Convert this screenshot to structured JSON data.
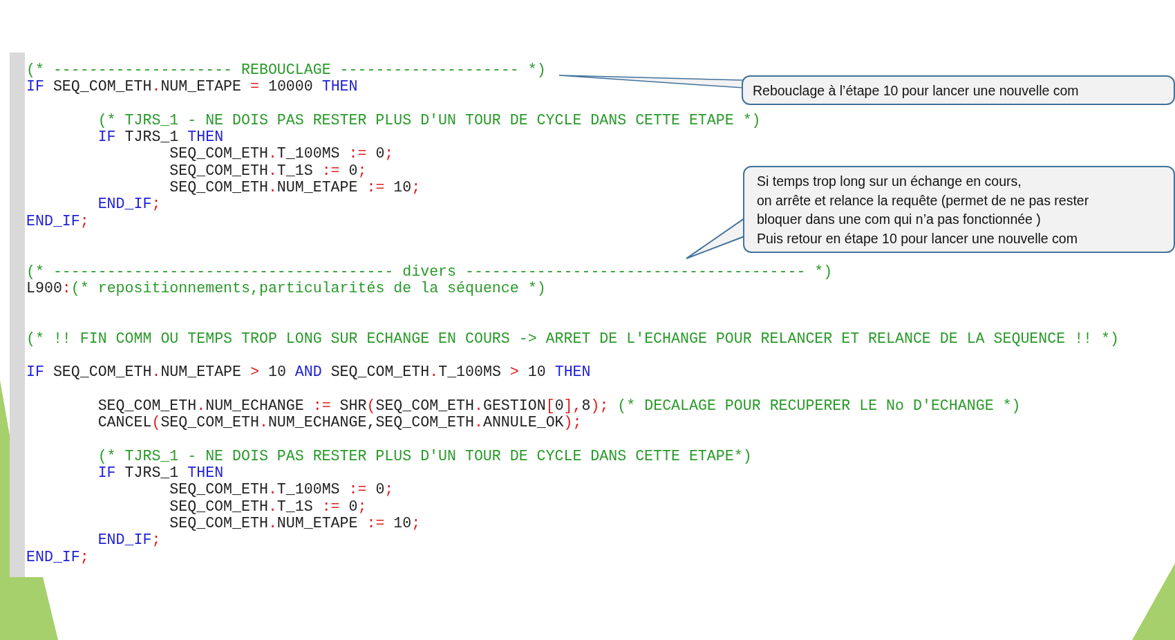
{
  "code_lines": [
    {
      "kind": "code",
      "tokens": [
        {
          "kind": "comment",
          "text": "(* -------------------- REBOUCLAGE -------------------- *)"
        }
      ]
    },
    {
      "kind": "code",
      "tokens": [
        {
          "kind": "keyword",
          "text": "IF"
        },
        {
          "kind": "plain",
          "text": " SEQ_COM_ETH"
        },
        {
          "kind": "operator",
          "text": "."
        },
        {
          "kind": "plain",
          "text": "NUM_ETAPE "
        },
        {
          "kind": "operator",
          "text": "="
        },
        {
          "kind": "plain",
          "text": " 10000 "
        },
        {
          "kind": "keyword",
          "text": "THEN"
        }
      ],
      "children": [
        {
          "kind": "blank"
        },
        {
          "kind": "code",
          "tokens": [
            {
              "kind": "comment",
              "text": "(* TJRS_1 - NE DOIS PAS RESTER PLUS D'UN TOUR DE CYCLE DANS CETTE ETAPE *)"
            }
          ]
        },
        {
          "kind": "code",
          "tokens": [
            {
              "kind": "keyword",
              "text": "IF"
            },
            {
              "kind": "plain",
              "text": " TJRS_1 "
            },
            {
              "kind": "keyword",
              "text": "THEN"
            }
          ],
          "children": [
            {
              "kind": "code",
              "tokens": [
                {
                  "kind": "plain",
                  "text": "SEQ_COM_ETH"
                },
                {
                  "kind": "operator",
                  "text": "."
                },
                {
                  "kind": "plain",
                  "text": "T_100MS "
                },
                {
                  "kind": "operator",
                  "text": ":="
                },
                {
                  "kind": "plain",
                  "text": " 0"
                },
                {
                  "kind": "operator",
                  "text": ";"
                }
              ]
            },
            {
              "kind": "code",
              "tokens": [
                {
                  "kind": "plain",
                  "text": "SEQ_COM_ETH"
                },
                {
                  "kind": "operator",
                  "text": "."
                },
                {
                  "kind": "plain",
                  "text": "T_1S "
                },
                {
                  "kind": "operator",
                  "text": ":="
                },
                {
                  "kind": "plain",
                  "text": " 0"
                },
                {
                  "kind": "operator",
                  "text": ";"
                }
              ]
            },
            {
              "kind": "code",
              "tokens": [
                {
                  "kind": "plain",
                  "text": "SEQ_COM_ETH"
                },
                {
                  "kind": "operator",
                  "text": "."
                },
                {
                  "kind": "plain",
                  "text": "NUM_ETAPE "
                },
                {
                  "kind": "operator",
                  "text": ":="
                },
                {
                  "kind": "plain",
                  "text": " 10"
                },
                {
                  "kind": "operator",
                  "text": ";"
                }
              ]
            }
          ]
        },
        {
          "kind": "code",
          "tokens": [
            {
              "kind": "keyword",
              "text": "END_IF"
            },
            {
              "kind": "operator",
              "text": ";"
            }
          ]
        }
      ]
    },
    {
      "kind": "code",
      "tokens": [
        {
          "kind": "keyword",
          "text": "END_IF"
        },
        {
          "kind": "operator",
          "text": ";"
        }
      ]
    },
    {
      "kind": "blank"
    },
    {
      "kind": "blank"
    },
    {
      "kind": "code",
      "tokens": [
        {
          "kind": "comment",
          "text": "(* -------------------------------------- divers -------------------------------------- *)"
        }
      ]
    },
    {
      "kind": "code",
      "tokens": [
        {
          "kind": "plain",
          "text": "L900"
        },
        {
          "kind": "operator",
          "text": ":"
        },
        {
          "kind": "comment",
          "text": "(* repositionnements,particularités de la séquence *)"
        }
      ]
    },
    {
      "kind": "blank"
    },
    {
      "kind": "blank"
    },
    {
      "kind": "code",
      "tokens": [
        {
          "kind": "comment",
          "text": "(* !! FIN COMM OU TEMPS TROP LONG SUR ECHANGE EN COURS -> ARRET DE L'ECHANGE POUR RELANCER ET RELANCE DE LA SEQUENCE !! *)"
        }
      ]
    },
    {
      "kind": "blank"
    },
    {
      "kind": "code",
      "tokens": [
        {
          "kind": "keyword",
          "text": "IF"
        },
        {
          "kind": "plain",
          "text": " SEQ_COM_ETH"
        },
        {
          "kind": "operator",
          "text": "."
        },
        {
          "kind": "plain",
          "text": "NUM_ETAPE "
        },
        {
          "kind": "operator",
          "text": ">"
        },
        {
          "kind": "plain",
          "text": " 10 "
        },
        {
          "kind": "keyword",
          "text": "AND"
        },
        {
          "kind": "plain",
          "text": " SEQ_COM_ETH"
        },
        {
          "kind": "operator",
          "text": "."
        },
        {
          "kind": "plain",
          "text": "T_100MS "
        },
        {
          "kind": "operator",
          "text": ">"
        },
        {
          "kind": "plain",
          "text": " 10 "
        },
        {
          "kind": "keyword",
          "text": "THEN"
        }
      ],
      "children": [
        {
          "kind": "blank"
        },
        {
          "kind": "code",
          "tokens": [
            {
              "kind": "plain",
              "text": "SEQ_COM_ETH"
            },
            {
              "kind": "operator",
              "text": "."
            },
            {
              "kind": "plain",
              "text": "NUM_ECHANGE "
            },
            {
              "kind": "operator",
              "text": ":="
            },
            {
              "kind": "plain",
              "text": " SHR"
            },
            {
              "kind": "operator",
              "text": "("
            },
            {
              "kind": "plain",
              "text": "SEQ_COM_ETH"
            },
            {
              "kind": "operator",
              "text": "."
            },
            {
              "kind": "plain",
              "text": "GESTION"
            },
            {
              "kind": "operator",
              "text": "["
            },
            {
              "kind": "plain",
              "text": "0"
            },
            {
              "kind": "operator",
              "text": "],"
            },
            {
              "kind": "plain",
              "text": "8"
            },
            {
              "kind": "operator",
              "text": ");"
            },
            {
              "kind": "comment",
              "text": " (* DECALAGE POUR RECUPERER LE No D'ECHANGE *)"
            }
          ]
        },
        {
          "kind": "code",
          "tokens": [
            {
              "kind": "plain",
              "text": "CANCEL"
            },
            {
              "kind": "operator",
              "text": "("
            },
            {
              "kind": "plain",
              "text": "SEQ_COM_ETH"
            },
            {
              "kind": "operator",
              "text": "."
            },
            {
              "kind": "plain",
              "text": "NUM_ECHANGE,SEQ_COM_ETH"
            },
            {
              "kind": "operator",
              "text": "."
            },
            {
              "kind": "plain",
              "text": "ANNULE_OK"
            },
            {
              "kind": "operator",
              "text": ");"
            }
          ]
        },
        {
          "kind": "blank"
        },
        {
          "kind": "code",
          "tokens": [
            {
              "kind": "comment",
              "text": "(* TJRS_1 - NE DOIS PAS RESTER PLUS D'UN TOUR DE CYCLE DANS CETTE ETAPE*)"
            }
          ]
        },
        {
          "kind": "code",
          "tokens": [
            {
              "kind": "keyword",
              "text": "IF"
            },
            {
              "kind": "plain",
              "text": " TJRS_1 "
            },
            {
              "kind": "keyword",
              "text": "THEN"
            }
          ],
          "children": [
            {
              "kind": "code",
              "tokens": [
                {
                  "kind": "plain",
                  "text": "SEQ_COM_ETH"
                },
                {
                  "kind": "operator",
                  "text": "."
                },
                {
                  "kind": "plain",
                  "text": "T_100MS "
                },
                {
                  "kind": "operator",
                  "text": ":="
                },
                {
                  "kind": "plain",
                  "text": " 0"
                },
                {
                  "kind": "operator",
                  "text": ";"
                }
              ]
            },
            {
              "kind": "code",
              "tokens": [
                {
                  "kind": "plain",
                  "text": "SEQ_COM_ETH"
                },
                {
                  "kind": "operator",
                  "text": "."
                },
                {
                  "kind": "plain",
                  "text": "T_1S "
                },
                {
                  "kind": "operator",
                  "text": ":="
                },
                {
                  "kind": "plain",
                  "text": " 0"
                },
                {
                  "kind": "operator",
                  "text": ";"
                }
              ]
            },
            {
              "kind": "code",
              "tokens": [
                {
                  "kind": "plain",
                  "text": "SEQ_COM_ETH"
                },
                {
                  "kind": "operator",
                  "text": "."
                },
                {
                  "kind": "plain",
                  "text": "NUM_ETAPE "
                },
                {
                  "kind": "operator",
                  "text": ":="
                },
                {
                  "kind": "plain",
                  "text": " 10"
                },
                {
                  "kind": "operator",
                  "text": ";"
                }
              ]
            }
          ]
        },
        {
          "kind": "code",
          "tokens": [
            {
              "kind": "keyword",
              "text": "END_IF"
            },
            {
              "kind": "operator",
              "text": ";"
            }
          ]
        }
      ]
    },
    {
      "kind": "code",
      "tokens": [
        {
          "kind": "keyword",
          "text": "END_IF"
        },
        {
          "kind": "operator",
          "text": ";"
        }
      ]
    }
  ],
  "callouts": [
    {
      "text": "Rebouclage à l’étape 10 pour lancer une nouvelle com"
    },
    {
      "text": "Si temps trop long sur un échange en cours,\non arrête et relance la requête (permet de ne pas rester\nbloquer dans une com qui n’a pas fonctionnée )\nPuis retour en étape 10 pour lancer une nouvelle com"
    }
  ]
}
